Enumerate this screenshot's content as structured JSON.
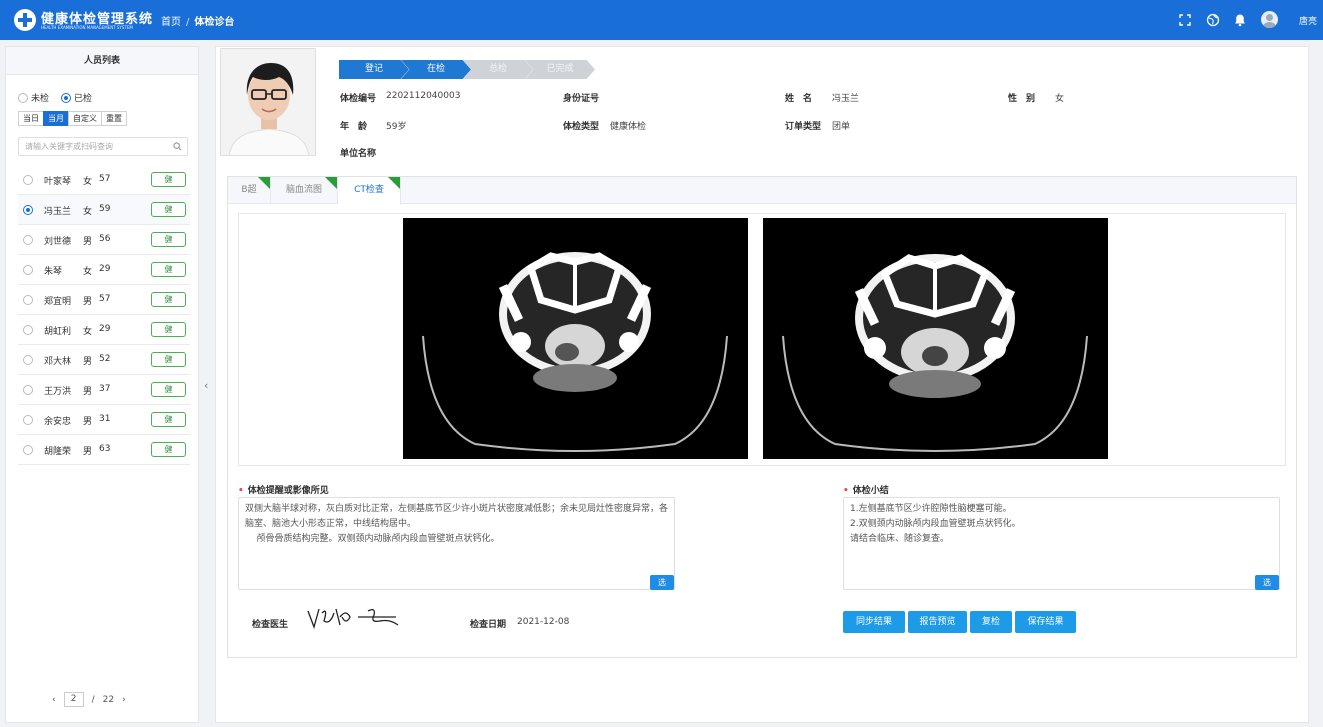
{
  "header": {
    "app_title": "健康体检管理系统",
    "app_subtitle": "HEALTH EXAMINATION MANAGEMENT SYSTEM",
    "breadcrumb": {
      "home": "首页",
      "separator": "/",
      "current": "体检诊台"
    },
    "username": "唐亮",
    "icons": [
      "fullscreen-icon",
      "globe-icon",
      "bell-icon",
      "user-avatar-icon"
    ]
  },
  "sidebar": {
    "title": "人员列表",
    "radio": [
      {
        "label": "未检",
        "checked": false
      },
      {
        "label": "已检",
        "checked": true
      }
    ],
    "range_buttons": [
      {
        "label": "当日",
        "active": false
      },
      {
        "label": "当月",
        "active": true
      },
      {
        "label": "自定义",
        "active": false
      },
      {
        "label": "重置",
        "active": false
      }
    ],
    "search": {
      "placeholder": "请输入关键字或扫码查询",
      "value": ""
    },
    "people": [
      {
        "name": "叶家琴",
        "sex": "女",
        "age": "57",
        "tag": "健",
        "selected": false
      },
      {
        "name": "冯玉兰",
        "sex": "女",
        "age": "59",
        "tag": "健",
        "selected": true
      },
      {
        "name": "刘世德",
        "sex": "男",
        "age": "56",
        "tag": "健",
        "selected": false
      },
      {
        "name": "朱琴",
        "sex": "女",
        "age": "29",
        "tag": "健",
        "selected": false
      },
      {
        "name": "郑宜明",
        "sex": "男",
        "age": "57",
        "tag": "健",
        "selected": false
      },
      {
        "name": "胡虹利",
        "sex": "女",
        "age": "29",
        "tag": "健",
        "selected": false
      },
      {
        "name": "邓大林",
        "sex": "男",
        "age": "52",
        "tag": "健",
        "selected": false
      },
      {
        "name": "王万洪",
        "sex": "男",
        "age": "37",
        "tag": "健",
        "selected": false
      },
      {
        "name": "余安忠",
        "sex": "男",
        "age": "31",
        "tag": "健",
        "selected": false
      },
      {
        "name": "胡隆荣",
        "sex": "男",
        "age": "63",
        "tag": "健",
        "selected": false
      }
    ],
    "pager": {
      "prev": "‹",
      "current": "2",
      "separator": "/",
      "total": "22",
      "next": "›"
    }
  },
  "patient": {
    "steps": [
      {
        "label": "登记",
        "done": true
      },
      {
        "label": "在检",
        "done": true
      },
      {
        "label": "总检",
        "done": false
      },
      {
        "label": "已完成",
        "done": false
      }
    ],
    "exam_no_label": "体检编号",
    "exam_no": "2202112040003",
    "id_no_label": "身份证号",
    "id_no": "",
    "name_label": "姓　名",
    "name": "冯玉兰",
    "sex_label": "性　别",
    "sex": "女",
    "age_label": "年　龄",
    "age": "59岁",
    "exam_type_label": "体检类型",
    "exam_type": "健康体检",
    "order_type_label": "订单类型",
    "order_type": "团单",
    "company_label": "单位名称",
    "company": ""
  },
  "tabs": [
    {
      "label": "B超",
      "active": false,
      "flag": true
    },
    {
      "label": "脑血流图",
      "active": false,
      "flag": true
    },
    {
      "label": "CT检查",
      "active": true,
      "flag": true
    }
  ],
  "findings": {
    "label": "体检提醒或影像所见",
    "text": "双侧大脑半球对称，灰白质对比正常，左侧基底节区少许小斑片状密度减低影；余未见局灶性密度异常，各脑室、脑池大小形态正常，中线结构居中。\n    颅骨骨质结构完整。双侧颈内动脉颅内段血管壁斑点状钙化。",
    "select_button": "选"
  },
  "summary": {
    "label": "体检小结",
    "text": "1.左侧基底节区少许腔隙性脑梗塞可能。\n2.双侧颈内动脉颅内段血管壁斑点状钙化。\n请结合临床、随诊复查。",
    "select_button": "选"
  },
  "footer": {
    "doctor_label": "检查医生",
    "date_label": "检查日期",
    "date": "2021-12-08",
    "buttons": [
      "同步结果",
      "报告预览",
      "复检",
      "保存结果"
    ]
  }
}
